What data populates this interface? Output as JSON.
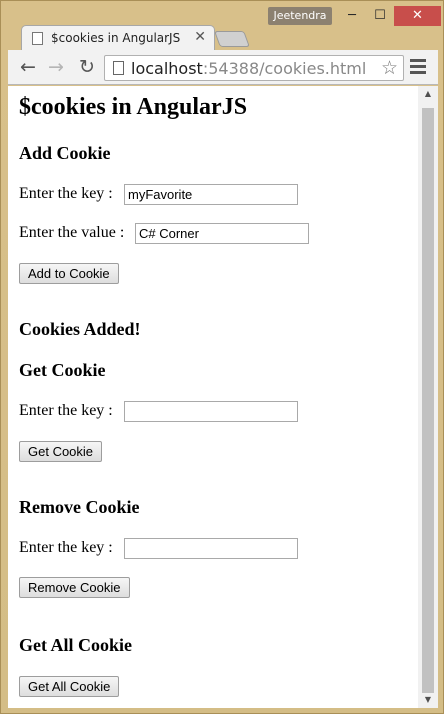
{
  "window": {
    "user": "Jeetendra",
    "minimize_glyph": "─",
    "maximize_glyph": "☐",
    "close_glyph": "✕"
  },
  "tab": {
    "title": "$cookies in AngularJS",
    "close_glyph": "✕"
  },
  "toolbar": {
    "back_glyph": "←",
    "forward_glyph": "→",
    "reload_glyph": "↻",
    "url_host": "localhost",
    "url_rest": ":54388/cookies.html",
    "star_glyph": "☆"
  },
  "page": {
    "title": "$cookies in AngularJS",
    "add_section": {
      "heading": "Add Cookie",
      "key_label": "Enter the key :",
      "key_value": "myFavorite",
      "value_label": "Enter the value :",
      "value_value": "C# Corner",
      "button": "Add to Cookie"
    },
    "status_message": "Cookies Added!",
    "get_section": {
      "heading": "Get Cookie",
      "key_label": "Enter the key :",
      "key_value": "",
      "button": "Get Cookie"
    },
    "remove_section": {
      "heading": "Remove Cookie",
      "key_label": "Enter the key :",
      "key_value": "",
      "button": "Remove Cookie"
    },
    "get_all_section": {
      "heading": "Get All Cookie",
      "button": "Get All Cookie"
    }
  },
  "scrollbar": {
    "up_glyph": "▲",
    "down_glyph": "▼"
  }
}
